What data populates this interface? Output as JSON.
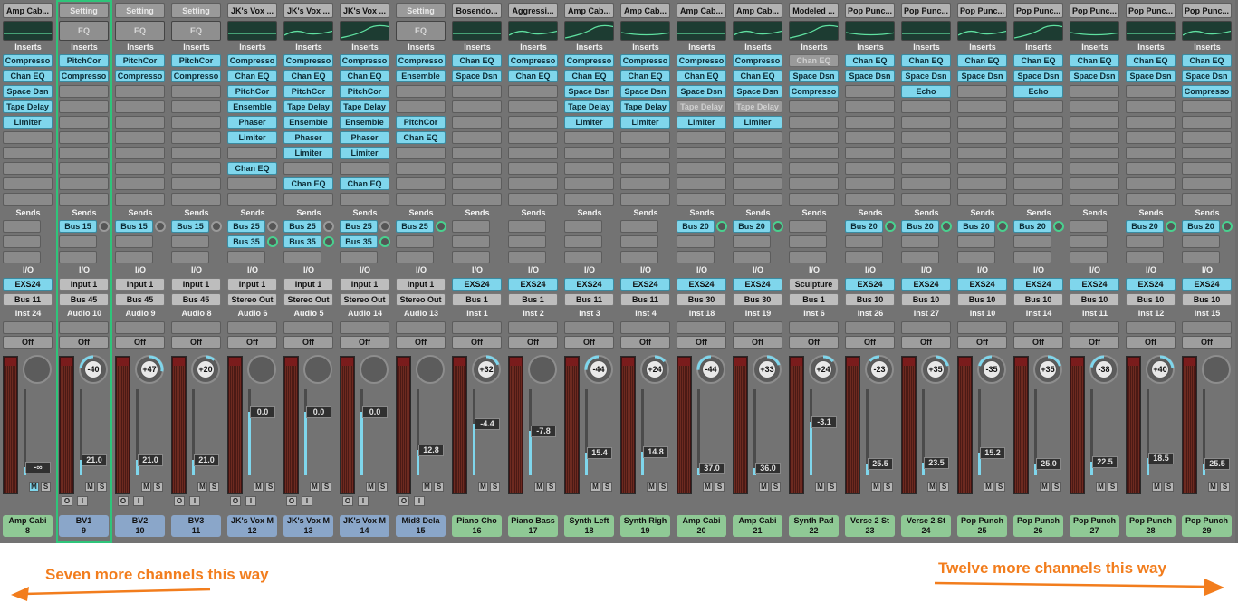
{
  "labels": {
    "inserts": "Inserts",
    "sends": "Sends",
    "io": "I/O",
    "mute": "M",
    "solo": "S",
    "input_mon": "O",
    "input_i": "I"
  },
  "annotations": {
    "left": "Seven more channels this way",
    "right": "Twelve more channels this way"
  },
  "colors": {
    "insert": "#7fd6ec",
    "green_name": "#8fc995",
    "blue_name": "#8aa6c9",
    "selected_outline": "#2fc47a",
    "annotation": "#f27d1d"
  },
  "channels": [
    {
      "setting": "Amp Cab...",
      "eq": "curve",
      "inserts": [
        "Compresso",
        "Chan EQ",
        "Space Dsn",
        "Tape Delay",
        "Limiter"
      ],
      "sends": [],
      "input": "EXS24",
      "output": "Bus 11",
      "track": "Inst 24",
      "automation": "Off",
      "pan": "",
      "volume": "-∞",
      "vol_level": 0.1,
      "muted": true,
      "name": "Amp Cabi",
      "number": "8",
      "color": "green"
    },
    {
      "setting": "Setting",
      "eq": "EQ",
      "inserts": [
        "PitchCor",
        "Compresso"
      ],
      "sends": [
        "Bus 15"
      ],
      "input": "Input 1",
      "output": "Bus 45",
      "track": "Audio 10",
      "automation": "Off",
      "pan": "-40",
      "volume": "21.0",
      "vol_level": 0.18,
      "muted": false,
      "name": "BV1",
      "number": "9",
      "color": "blue",
      "selected": true,
      "mono": true
    },
    {
      "setting": "Setting",
      "eq": "EQ",
      "inserts": [
        "PitchCor",
        "Compresso"
      ],
      "sends": [
        "Bus 15"
      ],
      "input": "Input 1",
      "output": "Bus 45",
      "track": "Audio 9",
      "automation": "Off",
      "pan": "+47",
      "volume": "21.0",
      "vol_level": 0.18,
      "muted": false,
      "name": "BV2",
      "number": "10",
      "color": "blue",
      "mono": true
    },
    {
      "setting": "Setting",
      "eq": "EQ",
      "inserts": [
        "PitchCor",
        "Compresso"
      ],
      "sends": [
        "Bus 15"
      ],
      "input": "Input 1",
      "output": "Bus 45",
      "track": "Audio 8",
      "automation": "Off",
      "pan": "+20",
      "volume": "21.0",
      "vol_level": 0.18,
      "muted": false,
      "name": "BV3",
      "number": "11",
      "color": "blue",
      "mono": true
    },
    {
      "setting": "JK's Vox ...",
      "eq": "curve",
      "inserts": [
        "Compresso",
        "Chan EQ",
        "PitchCor",
        "Ensemble",
        "Phaser",
        "Limiter",
        "",
        "Chan EQ"
      ],
      "sends": [
        "Bus 25",
        "Bus 35"
      ],
      "input": "Input 1",
      "output": "Stereo Out",
      "track": "Audio 6",
      "automation": "Off",
      "pan": "",
      "volume": "0.0",
      "vol_level": 0.74,
      "muted": false,
      "name": "JK's Vox M",
      "number": "12",
      "color": "blue"
    },
    {
      "setting": "JK's Vox ...",
      "eq": "curve",
      "inserts": [
        "Compresso",
        "Chan EQ",
        "PitchCor",
        "Tape Delay",
        "Ensemble",
        "Phaser",
        "Limiter",
        "",
        "Chan EQ"
      ],
      "sends": [
        "Bus 25",
        "Bus 35"
      ],
      "input": "Input 1",
      "output": "Stereo Out",
      "track": "Audio 5",
      "automation": "Off",
      "pan": "",
      "volume": "0.0",
      "vol_level": 0.74,
      "muted": false,
      "name": "JK's Vox M",
      "number": "13",
      "color": "blue"
    },
    {
      "setting": "JK's Vox ...",
      "eq": "curve",
      "inserts": [
        "Compresso",
        "Chan EQ",
        "PitchCor",
        "Tape Delay",
        "Ensemble",
        "Phaser",
        "Limiter",
        "",
        "Chan EQ"
      ],
      "sends": [
        "Bus 25",
        "Bus 35"
      ],
      "input": "Input 1",
      "output": "Stereo Out",
      "track": "Audio 14",
      "automation": "Off",
      "pan": "",
      "volume": "0.0",
      "vol_level": 0.74,
      "muted": false,
      "name": "JK's Vox M",
      "number": "14",
      "color": "blue"
    },
    {
      "setting": "Setting",
      "eq": "EQ",
      "inserts": [
        "Compresso",
        "Ensemble",
        "",
        "",
        "PitchCor",
        "Chan EQ"
      ],
      "sends": [
        "Bus 25"
      ],
      "input": "Input 1",
      "output": "Stereo Out",
      "track": "Audio 13",
      "automation": "Off",
      "pan": "",
      "volume": "12.8",
      "vol_level": 0.3,
      "muted": false,
      "name": "Mid8 Dela",
      "number": "15",
      "color": "blue"
    },
    {
      "setting": "Bosendo...",
      "eq": "curve",
      "inserts": [
        "Chan EQ",
        "Space Dsn"
      ],
      "sends": [],
      "input": "EXS24",
      "output": "Bus 1",
      "track": "Inst 1",
      "automation": "Off",
      "pan": "+32",
      "volume": "-4.4",
      "vol_level": 0.6,
      "muted": false,
      "name": "Piano Cho",
      "number": "16",
      "color": "green"
    },
    {
      "setting": "Aggressi...",
      "eq": "curve",
      "inserts": [
        "Compresso",
        "Chan EQ"
      ],
      "sends": [],
      "input": "EXS24",
      "output": "Bus 1",
      "track": "Inst 2",
      "automation": "Off",
      "pan": "",
      "volume": "-7.8",
      "vol_level": 0.52,
      "muted": false,
      "name": "Piano Bass",
      "number": "17",
      "color": "green"
    },
    {
      "setting": "Amp Cab...",
      "eq": "curve",
      "inserts": [
        "Compresso",
        "Chan EQ",
        "Space Dsn",
        "Tape Delay",
        "Limiter"
      ],
      "sends": [],
      "input": "EXS24",
      "output": "Bus 11",
      "track": "Inst 3",
      "automation": "Off",
      "pan": "-44",
      "volume": "15.4",
      "vol_level": 0.26,
      "muted": false,
      "name": "Synth Left",
      "number": "18",
      "color": "green"
    },
    {
      "setting": "Amp Cab...",
      "eq": "curve",
      "inserts": [
        "Compresso",
        "Chan EQ",
        "Space Dsn",
        "Tape Delay",
        "Limiter"
      ],
      "sends": [],
      "input": "EXS24",
      "output": "Bus 11",
      "track": "Inst 4",
      "automation": "Off",
      "pan": "+24",
      "volume": "14.8",
      "vol_level": 0.27,
      "muted": false,
      "name": "Synth Righ",
      "number": "19",
      "color": "green"
    },
    {
      "setting": "Amp Cab...",
      "eq": "curve",
      "inserts": [
        "Compresso",
        "Chan EQ",
        "Space Dsn",
        "Tape Delay*",
        "Limiter"
      ],
      "sends": [
        "Bus 20"
      ],
      "input": "EXS24",
      "output": "Bus 30",
      "track": "Inst 18",
      "automation": "Off",
      "pan": "-44",
      "volume": "37.0",
      "vol_level": 0.08,
      "muted": false,
      "name": "Amp Cabi",
      "number": "20",
      "color": "green"
    },
    {
      "setting": "Amp Cab...",
      "eq": "curve",
      "inserts": [
        "Compresso",
        "Chan EQ",
        "Space Dsn",
        "Tape Delay*",
        "Limiter"
      ],
      "sends": [
        "Bus 20"
      ],
      "input": "EXS24",
      "output": "Bus 30",
      "track": "Inst 19",
      "automation": "Off",
      "pan": "+33",
      "volume": "36.0",
      "vol_level": 0.08,
      "muted": false,
      "name": "Amp Cabi",
      "number": "21",
      "color": "green"
    },
    {
      "setting": "Modeled ...",
      "eq": "curve",
      "inserts": [
        "Chan EQ*",
        "Space Dsn",
        "Compresso"
      ],
      "sends": [],
      "input": "Sculpture",
      "output": "Bus 1",
      "track": "Inst 6",
      "automation": "Off",
      "pan": "+24",
      "volume": "-3.1",
      "vol_level": 0.62,
      "muted": false,
      "name": "Synth Pad",
      "number": "22",
      "color": "green"
    },
    {
      "setting": "Pop Punc...",
      "eq": "curve",
      "inserts": [
        "Chan EQ",
        "Space Dsn"
      ],
      "sends": [
        "Bus 20"
      ],
      "input": "EXS24",
      "output": "Bus 10",
      "track": "Inst 26",
      "automation": "Off",
      "pan": "-23",
      "volume": "25.5",
      "vol_level": 0.14,
      "muted": false,
      "name": "Verse 2 St",
      "number": "23",
      "color": "green"
    },
    {
      "setting": "Pop Punc...",
      "eq": "curve",
      "inserts": [
        "Chan EQ",
        "Space Dsn",
        "Echo"
      ],
      "sends": [
        "Bus 20"
      ],
      "input": "EXS24",
      "output": "Bus 10",
      "track": "Inst 27",
      "automation": "Off",
      "pan": "+35",
      "volume": "23.5",
      "vol_level": 0.15,
      "muted": false,
      "name": "Verse 2 St",
      "number": "24",
      "color": "green"
    },
    {
      "setting": "Pop Punc...",
      "eq": "curve",
      "inserts": [
        "Chan EQ",
        "Space Dsn"
      ],
      "sends": [
        "Bus 20"
      ],
      "input": "EXS24",
      "output": "Bus 10",
      "track": "Inst 10",
      "automation": "Off",
      "pan": "-35",
      "volume": "15.2",
      "vol_level": 0.26,
      "muted": false,
      "name": "Pop Punch",
      "number": "25",
      "color": "green"
    },
    {
      "setting": "Pop Punc...",
      "eq": "curve",
      "inserts": [
        "Chan EQ",
        "Space Dsn",
        "Echo"
      ],
      "sends": [
        "Bus 20"
      ],
      "input": "EXS24",
      "output": "Bus 10",
      "track": "Inst 14",
      "automation": "Off",
      "pan": "+35",
      "volume": "25.0",
      "vol_level": 0.14,
      "muted": false,
      "name": "Pop Punch",
      "number": "26",
      "color": "green"
    },
    {
      "setting": "Pop Punc...",
      "eq": "curve",
      "inserts": [
        "Chan EQ",
        "Space Dsn"
      ],
      "sends": [],
      "input": "EXS24",
      "output": "Bus 10",
      "track": "Inst 11",
      "automation": "Off",
      "pan": "-38",
      "volume": "22.5",
      "vol_level": 0.16,
      "muted": false,
      "name": "Pop Punch",
      "number": "27",
      "color": "green"
    },
    {
      "setting": "Pop Punc...",
      "eq": "curve",
      "inserts": [
        "Chan EQ",
        "Space Dsn"
      ],
      "sends": [
        "Bus 20"
      ],
      "input": "EXS24",
      "output": "Bus 10",
      "track": "Inst 12",
      "automation": "Off",
      "pan": "+40",
      "volume": "18.5",
      "vol_level": 0.2,
      "muted": false,
      "name": "Pop Punch",
      "number": "28",
      "color": "green"
    },
    {
      "setting": "Pop Punc...",
      "eq": "curve",
      "inserts": [
        "Chan EQ",
        "Space Dsn",
        "Compresso"
      ],
      "sends": [
        "Bus 20"
      ],
      "input": "EXS24",
      "output": "Bus 10",
      "track": "Inst 15",
      "automation": "Off",
      "pan": "",
      "volume": "25.5",
      "vol_level": 0.14,
      "muted": false,
      "name": "Pop Punch",
      "number": "29",
      "color": "green"
    }
  ]
}
